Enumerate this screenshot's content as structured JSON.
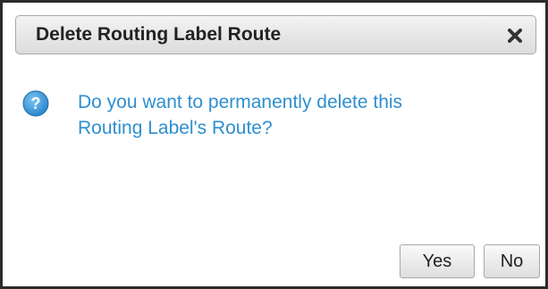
{
  "dialog": {
    "title": "Delete Routing Label Route",
    "close_icon": "close-icon",
    "question_icon": "question-icon",
    "message_line1": "Do you want to permanently delete this",
    "message_line2": "Routing Label's Route?",
    "buttons": {
      "yes_label": "Yes",
      "no_label": "No"
    },
    "colors": {
      "message_text": "#2e8fd0",
      "icon_fill": "#3a9ad9"
    }
  }
}
